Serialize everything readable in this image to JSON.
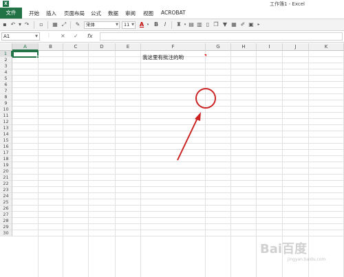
{
  "window": {
    "title": "工作簿1 - Excel"
  },
  "ribbon": {
    "tabs": [
      {
        "label": "文件"
      },
      {
        "label": "开始"
      },
      {
        "label": "插入"
      },
      {
        "label": "页面布局"
      },
      {
        "label": "公式"
      },
      {
        "label": "数据"
      },
      {
        "label": "审阅"
      },
      {
        "label": "视图"
      },
      {
        "label": "ACROBAT"
      }
    ]
  },
  "toolbar": {
    "font_name": "宋体",
    "font_size": "11",
    "bold": "B",
    "italic": "I",
    "font_color": "#c00000"
  },
  "formula_bar": {
    "name_box": "A1",
    "fx": "fx",
    "cancel": "✕",
    "enter": "✓",
    "value": ""
  },
  "sheet": {
    "columns": [
      "A",
      "B",
      "C",
      "D",
      "E",
      "F",
      "G",
      "H",
      "I",
      "J",
      "K"
    ],
    "rows": [
      "1",
      "2",
      "3",
      "4",
      "5",
      "6",
      "7",
      "8",
      "9",
      "10",
      "11",
      "12",
      "13",
      "14",
      "15",
      "16",
      "17",
      "18",
      "19",
      "20",
      "21",
      "22",
      "23",
      "24",
      "25",
      "26",
      "27",
      "28",
      "29",
      "30"
    ],
    "selected_cell": "A1",
    "cell_f7": "我这里有批注的哟",
    "comment_indicator_color": "#dd0000"
  },
  "annotation": {
    "color": "#cc2222"
  },
  "watermark": {
    "text": "Bai百度",
    "sub": "jingyan.baidu.com"
  }
}
